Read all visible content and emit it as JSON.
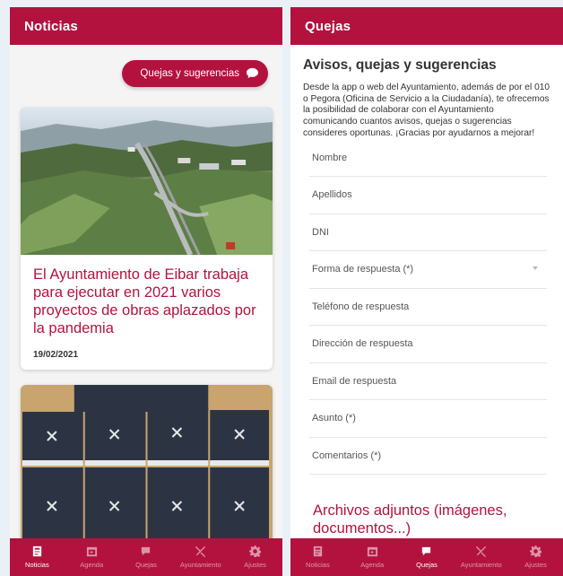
{
  "colors": {
    "brand": "#b3123f",
    "background": "#e9f1f7"
  },
  "left_screen": {
    "title": "Noticias",
    "quejas_button_label": "Quejas y sugerencias",
    "news": [
      {
        "title": "El Ayuntamiento de Eibar trabaja para ejecutar en 2021 varios proyectos de obras aplazados por la pandemia",
        "date": "19/02/2021",
        "image": "aerial-valley-highway-photo"
      },
      {
        "title": "",
        "date": "",
        "image": "booklets-photo"
      }
    ]
  },
  "right_screen": {
    "title": "Quejas",
    "heading": "Avisos, quejas y sugerencias",
    "intro": "Desde la app o web del Ayuntamiento, además de por el 010 o Pegora (Oficina de Servicio a la Ciudadanía), te ofrecemos la posibilidad de colaborar con el Ayuntamiento comunicando cuantos avisos, quejas o sugerencias consideres oportunas. ¡Gracias por ayudarnos a mejorar!",
    "fields": {
      "nombre": "Nombre",
      "apellidos": "Apellidos",
      "dni": "DNI",
      "forma_respuesta": "Forma de respuesta (*)",
      "telefono": "Teléfono de respuesta",
      "direccion": "Dirección de respuesta",
      "email": "Email de respuesta",
      "asunto": "Asunto (*)",
      "comentarios": "Comentarios (*)"
    },
    "attachments_heading": "Archivos adjuntos (imágenes, documentos...)"
  },
  "nav": {
    "noticias": "Noticias",
    "agenda": "Agenda",
    "quejas": "Quejas",
    "ayuntamiento": "Ayuntamiento",
    "ajustes": "Ajustes"
  }
}
